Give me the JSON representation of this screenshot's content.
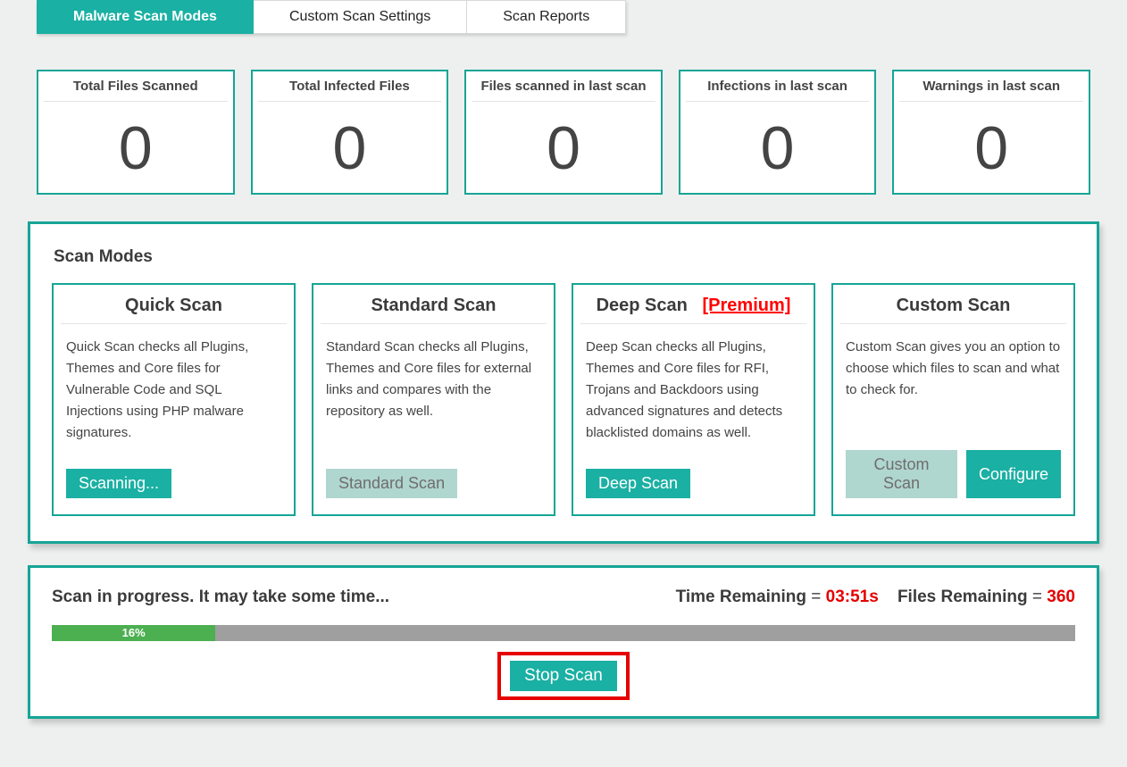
{
  "tabs": {
    "items": [
      {
        "label": "Malware Scan Modes",
        "active": true
      },
      {
        "label": "Custom Scan Settings",
        "active": false
      },
      {
        "label": "Scan Reports",
        "active": false
      }
    ]
  },
  "stats": [
    {
      "title": "Total Files Scanned",
      "value": "0"
    },
    {
      "title": "Total Infected Files",
      "value": "0"
    },
    {
      "title": "Files scanned in last scan",
      "value": "0"
    },
    {
      "title": "Infections in last scan",
      "value": "0"
    },
    {
      "title": "Warnings in last scan",
      "value": "0"
    }
  ],
  "scan_modes": {
    "heading": "Scan Modes",
    "cards": [
      {
        "title": "Quick Scan",
        "premium": "",
        "desc": "Quick Scan checks all Plugins, Themes and Core files for Vulnerable Code and SQL Injections using PHP malware signatures.",
        "primary_btn": "Scanning...",
        "primary_state": "active",
        "secondary_btn": ""
      },
      {
        "title": "Standard Scan",
        "premium": "",
        "desc": "Standard Scan checks all Plugins, Themes and Core files for external links and compares with the repository as well.",
        "primary_btn": "Standard Scan",
        "primary_state": "muted",
        "secondary_btn": ""
      },
      {
        "title": "Deep Scan",
        "premium": "[Premium]",
        "desc": "Deep Scan checks all Plugins, Themes and Core files for RFI, Trojans and Backdoors using advanced signatures and detects blacklisted domains as well.",
        "primary_btn": "Deep Scan",
        "primary_state": "normal",
        "secondary_btn": ""
      },
      {
        "title": "Custom Scan",
        "premium": "",
        "desc": "Custom Scan gives you an option to choose which files to scan and what to check for.",
        "primary_btn": "Custom Scan",
        "primary_state": "muted",
        "secondary_btn": "Configure"
      }
    ]
  },
  "progress": {
    "message": "Scan in progress. It may take some time...",
    "time_label": "Time Remaining",
    "time_value": "03:51",
    "time_unit": "s",
    "files_label": "Files Remaining",
    "files_value": "360",
    "percent": 16,
    "percent_label": "16%",
    "stop_label": "Stop Scan"
  }
}
